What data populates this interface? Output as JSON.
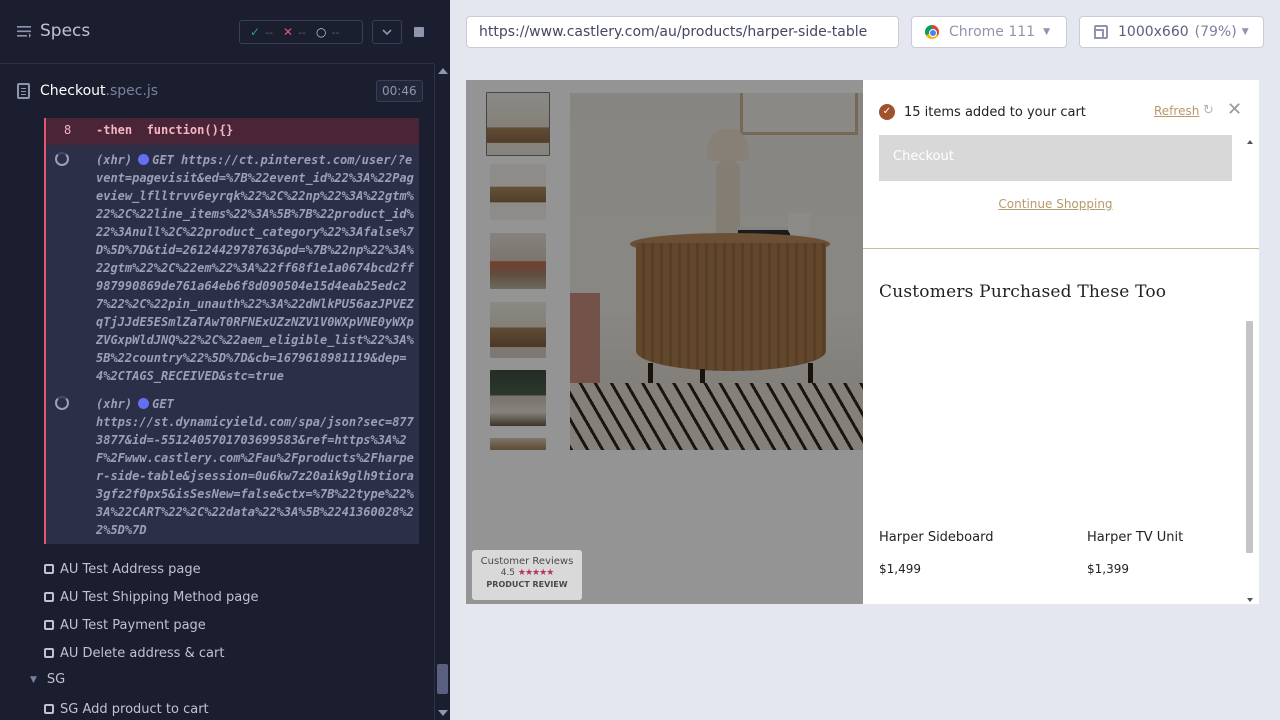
{
  "reporter": {
    "title": "Specs",
    "stats": {
      "passed": "--",
      "failed": "--",
      "pending": "--"
    },
    "spec": {
      "name": "Checkout",
      "ext": ".spec.js",
      "duration": "00:46"
    },
    "then_cmd": {
      "number": "8",
      "name": "-then",
      "arg": "function(){}"
    },
    "xhr_requests": [
      {
        "type": "(xhr)",
        "method": "GET",
        "url": "https://ct.pinterest.com/user/?event=pagevisit&ed=%7B%22event_id%22%3A%22Pageview_lflltrvv6eyrqk%22%2C%22np%22%3A%22gtm%22%2C%22line_items%22%3A%5B%7B%22product_id%22%3Anull%2C%22product_category%22%3Afalse%7D%5D%7D&tid=2612442978763&pd=%7B%22np%22%3A%22gtm%22%2C%22em%22%3A%22ff68f1e1a0674bcd2ff987990869de761a64eb6f8d090504e15d4eab25edc27%22%2C%22pin_unauth%22%3A%22dWlkPU56azJPVEZqTjJJdE5ESmlZaTAwT0RFNExUZzNZV1V0WXpVNE0yWXpZVGxpWldJNQ%22%2C%22aem_eligible_list%22%3A%5B%22country%22%5D%7D&cb=1679618981119&dep=4%2CTAGS_RECEIVED&stc=true"
      },
      {
        "type": "(xhr)",
        "method": "GET",
        "url": "https://st.dynamicyield.com/spa/json?sec=8773877&id=-5512405701703699583&ref=https%3A%2F%2Fwww.castlery.com%2Fau%2Fproducts%2Fharper-side-table&jsession=0u6kw7z20aik9glh9tiora3gfz2f0px5&isSesNew=false&ctx=%7B%22type%22%3A%22CART%22%2C%22data%22%3A%5B%2241360028%22%5D%7D"
      }
    ],
    "tests": [
      "AU Test Address page",
      "AU Test Shipping Method page",
      "AU Test Payment page",
      "AU Delete address & cart"
    ],
    "suite_sg": "SG",
    "sg_tests": [
      "SG Add product to cart"
    ]
  },
  "toolbar": {
    "url": "https://www.castlery.com/au/products/harper-side-table",
    "browser": "Chrome 111",
    "viewport": "1000x660",
    "zoom": "(79%)"
  },
  "aut": {
    "reviews": {
      "title": "Customer Reviews",
      "rating": "4.5",
      "stars": "★★★★★",
      "brand": "PRODUCT REVIEW"
    },
    "cart": {
      "status": "15 items added to your cart",
      "refresh": "Refresh",
      "checkout": "Checkout",
      "continue": "Continue Shopping",
      "also_bought_title": "Customers Purchased These Too",
      "products": [
        {
          "name": "Harper Sideboard",
          "price": "$1,499"
        },
        {
          "name": "Harper TV Unit",
          "price": "$1,399"
        }
      ]
    }
  },
  "colors": {
    "reporter_bg": "#1b1e2e",
    "fail": "#e45770",
    "pass": "#1fa971",
    "accent": "#b79a6b"
  }
}
